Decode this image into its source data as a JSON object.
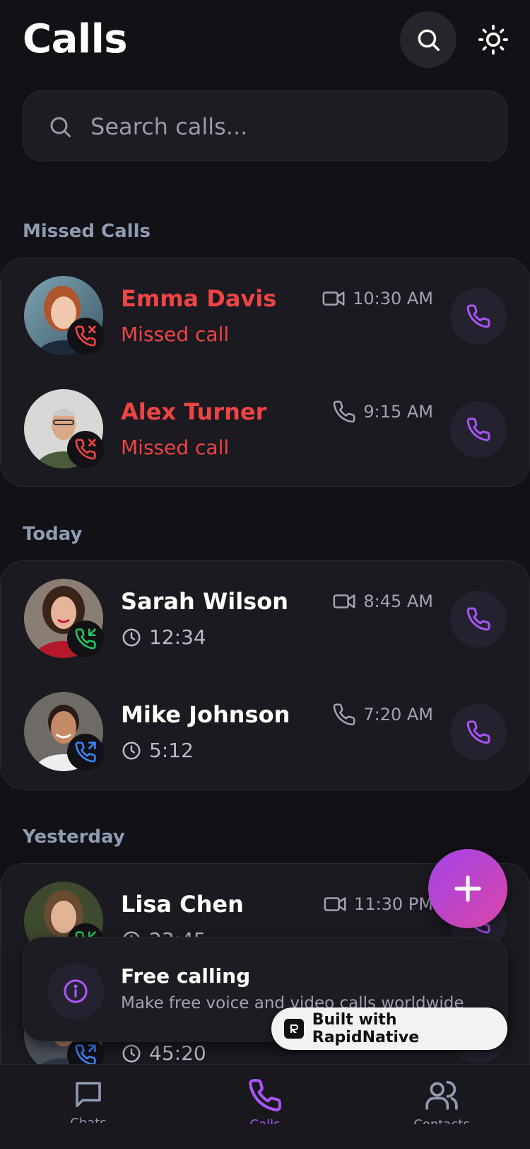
{
  "header": {
    "title": "Calls"
  },
  "search": {
    "placeholder": "Search calls..."
  },
  "sections": {
    "missed": "Missed Calls",
    "today": "Today",
    "yesterday": "Yesterday"
  },
  "calls": {
    "emma": {
      "name": "Emma Davis",
      "subtitle": "Missed call",
      "time": "10:30 AM",
      "type_icon": "video-icon",
      "status_icon": "phone-missed-icon"
    },
    "alex": {
      "name": "Alex Turner",
      "subtitle": "Missed call",
      "time": "9:15 AM",
      "type_icon": "phone-icon",
      "status_icon": "phone-missed-icon"
    },
    "sarah": {
      "name": "Sarah Wilson",
      "duration": "12:34",
      "time": "8:45 AM",
      "type_icon": "video-icon",
      "status_icon": "phone-incoming-icon"
    },
    "mike": {
      "name": "Mike Johnson",
      "duration": "5:12",
      "time": "7:20 AM",
      "type_icon": "phone-icon",
      "status_icon": "phone-outgoing-icon"
    },
    "lisa": {
      "name": "Lisa Chen",
      "duration": "23:45",
      "time": "11:30 PM",
      "type_icon": "video-icon",
      "status_icon": "phone-incoming-icon"
    },
    "hidden": {
      "duration": "45:20",
      "status_icon": "phone-outgoing-icon"
    }
  },
  "toast": {
    "title": "Free calling",
    "text": "Make free voice and video calls worldwide"
  },
  "badge": {
    "label": "Built with RapidNative"
  },
  "tabs": {
    "chats": "Chats",
    "calls": "Calls",
    "contacts": "Contacts"
  },
  "colors": {
    "background": "#111116",
    "card": "#1a1a20",
    "accent": "#a855f7",
    "missed": "#ef4444",
    "incoming": "#22c55e",
    "outgoing": "#3b82f6"
  }
}
